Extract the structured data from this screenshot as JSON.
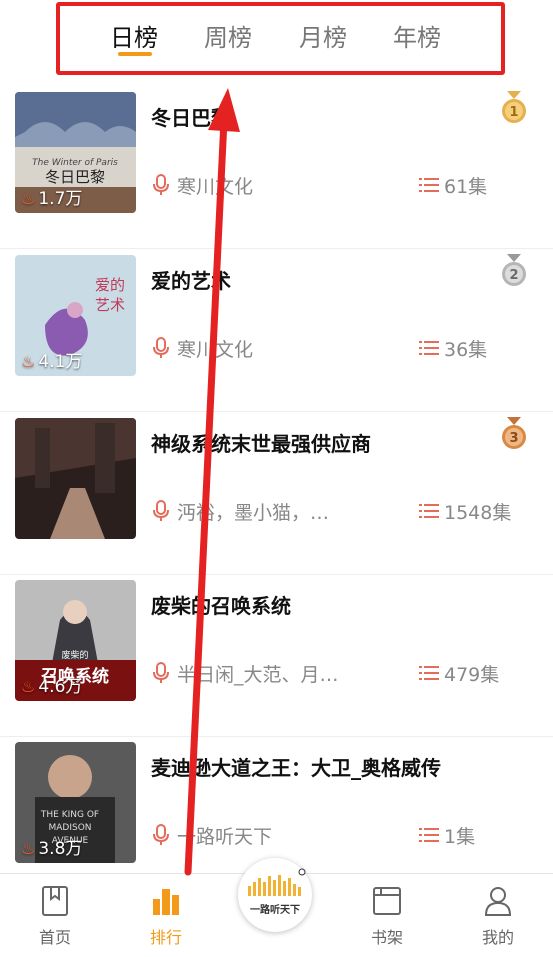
{
  "tabs": [
    {
      "label": "日榜",
      "active": true
    },
    {
      "label": "周榜",
      "active": false
    },
    {
      "label": "月榜",
      "active": false
    },
    {
      "label": "年榜",
      "active": false
    }
  ],
  "items": [
    {
      "rank": "1",
      "medal_color": "#e6b04a",
      "title": "冬日巴黎",
      "author": "寒川文化",
      "episodes": "61集",
      "plays": "1.7万",
      "cover_text": "The Winter of Paris  冬日巴黎"
    },
    {
      "rank": "2",
      "medal_color": "#b5b5b5",
      "title": "爱的艺术",
      "author": "寒川文化",
      "episodes": "36集",
      "plays": "4.1万",
      "cover_text": "爱的艺术"
    },
    {
      "rank": "3",
      "medal_color": "#d88a45",
      "title": "神级系统末世最强供应商",
      "author": "沔裕，墨小猫，…",
      "episodes": "1548集",
      "plays": "",
      "cover_text": ""
    },
    {
      "rank": "",
      "medal_color": "",
      "title": "废柴的召唤系统",
      "author": "半日闲_大范、月…",
      "episodes": "479集",
      "plays": "4.6万",
      "cover_text": "废柴的 召唤系统"
    },
    {
      "rank": "",
      "medal_color": "",
      "title": "麦迪逊大道之王：大卫_奥格威传",
      "author": "一路听天下",
      "episodes": "1集",
      "plays": "3.8万",
      "cover_text": "THE KING OF MADISON AVENUE"
    }
  ],
  "navbar": {
    "items": [
      {
        "label": "首页",
        "icon": "bookmark-book-icon",
        "active": false
      },
      {
        "label": "排行",
        "icon": "bar-chart-icon",
        "active": true
      },
      {
        "label": "书架",
        "icon": "bookshelf-icon",
        "active": false
      },
      {
        "label": "我的",
        "icon": "person-icon",
        "active": false
      }
    ],
    "logo_text": "一路听天下"
  },
  "colors": {
    "accent": "#f39a1a",
    "annotation_red": "#e52222",
    "secondary_icon": "#e46c5a"
  }
}
